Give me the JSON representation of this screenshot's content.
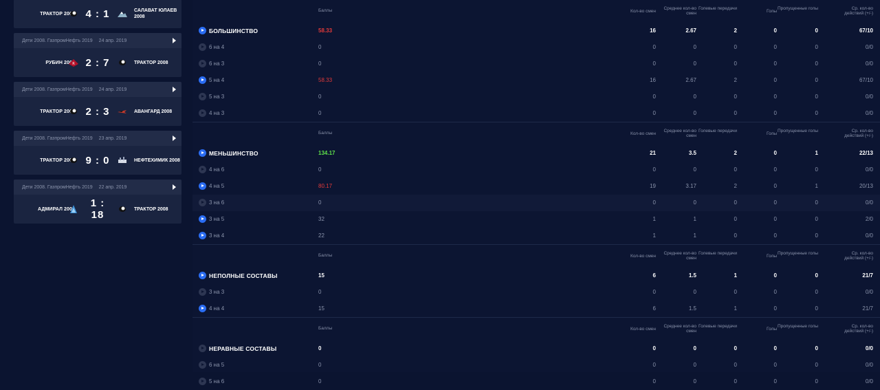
{
  "matches": [
    {
      "head": null,
      "date": null,
      "left_team": "ТРАКТОР 2008",
      "score": "4 : 1",
      "right_team": "САЛАВАТ ЮЛАЕВ 2008",
      "left_logo": "tractor-logo-icon",
      "right_logo": "mountain-logo-icon"
    },
    {
      "head": "Дети 2008. ГазпромНефть 2019",
      "date": "24 апр. 2019",
      "left_team": "РУБИН 2008",
      "score": "2 : 7",
      "right_team": "ТРАКТОР 2008",
      "left_logo": "rubin-logo-icon",
      "right_logo": "tractor-logo-icon"
    },
    {
      "head": "Дети 2008. ГазпромНефть 2019",
      "date": "24 апр. 2019",
      "left_team": "ТРАКТОР 2008",
      "score": "2 : 3",
      "right_team": "АВАНГАРД 2008",
      "left_logo": "tractor-logo-icon",
      "right_logo": "avangard-logo-icon"
    },
    {
      "head": "Дети 2008. ГазпромНефть 2019",
      "date": "23 апр. 2019",
      "left_team": "ТРАКТОР 2008",
      "score": "9 : 0",
      "right_team": "НЕФТЕХИМИК 2008",
      "left_logo": "tractor-logo-icon",
      "right_logo": "neftekhimik-logo-icon"
    },
    {
      "head": "Дети 2008. ГазпромНефть 2019",
      "date": "22 апр. 2019",
      "left_team": "АДМИРАЛ 2008",
      "score": "1 : 18",
      "right_team": "ТРАКТОР 2008",
      "left_logo": "admiral-logo-icon",
      "right_logo": "tractor-logo-icon"
    }
  ],
  "headers": {
    "score": "Баллы",
    "shifts": "Кол-во смен",
    "avg": "Среднее кол-во смен",
    "assists": "Голевые передачи",
    "goals": "Голы",
    "missed": "Пропущенные голы",
    "ratio": "Ср. кол-во действий (+/-)"
  },
  "sections": [
    {
      "title": "БОЛЬШИНСТВО",
      "score": "58.33",
      "shifts": "16",
      "avg": "2.67",
      "assists": "2",
      "goals": "0",
      "missed": "0",
      "ratio": "67/10",
      "score_color": "red",
      "active": true,
      "rows": [
        {
          "label": "6 на 4",
          "score": "0",
          "shifts": "0",
          "avg": "0",
          "assists": "0",
          "goals": "0",
          "missed": "0",
          "ratio": "0/0",
          "active": false
        },
        {
          "label": "6 на 3",
          "score": "0",
          "shifts": "0",
          "avg": "0",
          "assists": "0",
          "goals": "0",
          "missed": "0",
          "ratio": "0/0",
          "active": false
        },
        {
          "label": "5 на 4",
          "score": "58.33",
          "shifts": "16",
          "avg": "2.67",
          "assists": "2",
          "goals": "0",
          "missed": "0",
          "ratio": "67/10",
          "active": true,
          "score_color": "red"
        },
        {
          "label": "5 на 3",
          "score": "0",
          "shifts": "0",
          "avg": "0",
          "assists": "0",
          "goals": "0",
          "missed": "0",
          "ratio": "0/0",
          "active": false
        },
        {
          "label": "4 на 3",
          "score": "0",
          "shifts": "0",
          "avg": "0",
          "assists": "0",
          "goals": "0",
          "missed": "0",
          "ratio": "0/0",
          "active": false
        }
      ]
    },
    {
      "title": "МЕНЬШИНСТВО",
      "score": "134.17",
      "shifts": "21",
      "avg": "3.5",
      "assists": "2",
      "goals": "0",
      "missed": "1",
      "ratio": "22/13",
      "score_color": "green",
      "active": true,
      "rows": [
        {
          "label": "4 на 6",
          "score": "0",
          "shifts": "0",
          "avg": "0",
          "assists": "0",
          "goals": "0",
          "missed": "0",
          "ratio": "0/0",
          "active": false
        },
        {
          "label": "4 на 5",
          "score": "80.17",
          "shifts": "19",
          "avg": "3.17",
          "assists": "2",
          "goals": "0",
          "missed": "1",
          "ratio": "20/13",
          "active": true,
          "score_color": "red"
        },
        {
          "label": "3 на 6",
          "score": "0",
          "shifts": "0",
          "avg": "0",
          "assists": "0",
          "goals": "0",
          "missed": "0",
          "ratio": "0/0",
          "active": false,
          "alt": true
        },
        {
          "label": "3 на 5",
          "score": "32",
          "shifts": "1",
          "avg": "1",
          "assists": "0",
          "goals": "0",
          "missed": "0",
          "ratio": "2/0",
          "active": true
        },
        {
          "label": "3 на 4",
          "score": "22",
          "shifts": "1",
          "avg": "1",
          "assists": "0",
          "goals": "0",
          "missed": "0",
          "ratio": "0/0",
          "active": true
        }
      ]
    },
    {
      "title": "НЕПОЛНЫЕ СОСТАВЫ",
      "score": "15",
      "shifts": "6",
      "avg": "1.5",
      "assists": "1",
      "goals": "0",
      "missed": "0",
      "ratio": "21/7",
      "score_color": "",
      "active": true,
      "rows": [
        {
          "label": "3 на 3",
          "score": "0",
          "shifts": "0",
          "avg": "0",
          "assists": "0",
          "goals": "0",
          "missed": "0",
          "ratio": "0/0",
          "active": false
        },
        {
          "label": "4 на 4",
          "score": "15",
          "shifts": "6",
          "avg": "1.5",
          "assists": "1",
          "goals": "0",
          "missed": "0",
          "ratio": "21/7",
          "active": true
        }
      ]
    },
    {
      "title": "НЕРАВНЫЕ СОСТАВЫ",
      "score": "0",
      "shifts": "0",
      "avg": "0",
      "assists": "0",
      "goals": "0",
      "missed": "0",
      "ratio": "0/0",
      "score_color": "",
      "active": false,
      "rows": [
        {
          "label": "6 на 5",
          "score": "0",
          "shifts": "0",
          "avg": "0",
          "assists": "0",
          "goals": "0",
          "missed": "0",
          "ratio": "0/0",
          "active": false
        },
        {
          "label": "5 на 6",
          "score": "0",
          "shifts": "0",
          "avg": "0",
          "assists": "0",
          "goals": "0",
          "missed": "0",
          "ratio": "0/0",
          "active": false
        }
      ]
    }
  ],
  "colors": {
    "accent": "#2a6cf2",
    "red": "#e23a3a",
    "green": "#5ee04a",
    "bg": "#0b1430"
  }
}
